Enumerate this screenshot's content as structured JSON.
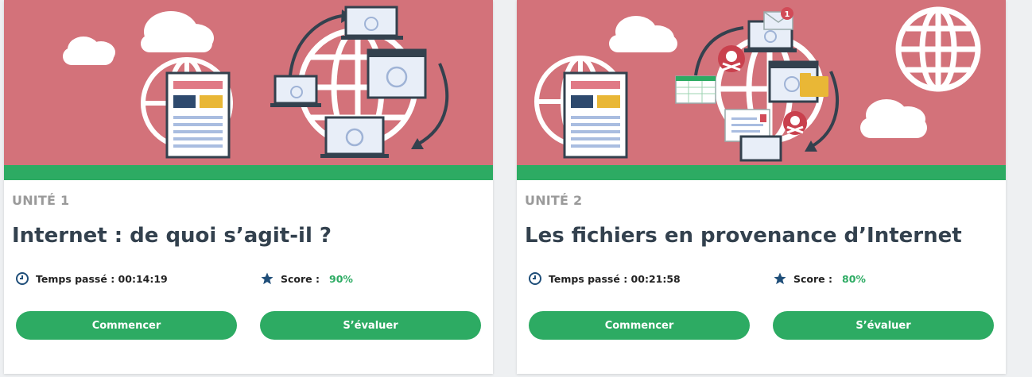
{
  "colors": {
    "banner_bg": "#d3727a",
    "accent_green": "#2dab63",
    "label_gray": "#9a9a9a",
    "title_dark": "#33414e",
    "icon_blue": "#1f4e79"
  },
  "cards": [
    {
      "unit_label": "UNITÉ 1",
      "title": "Internet : de quoi s’agit-il ?",
      "time_text": "Temps passé : 00:14:19",
      "score_label": "Score :",
      "score_value": "90%",
      "start_label": "Commencer",
      "eval_label": "S’évaluer",
      "illustration": "internet-network-illustration"
    },
    {
      "unit_label": "UNITÉ 2",
      "title": "Les fichiers en provenance d’Internet",
      "time_text": "Temps passé : 00:21:58",
      "score_label": "Score :",
      "score_value": "80%",
      "start_label": "Commencer",
      "eval_label": "S’évaluer",
      "illustration": "internet-files-malware-illustration",
      "notification_count": "1"
    }
  ]
}
